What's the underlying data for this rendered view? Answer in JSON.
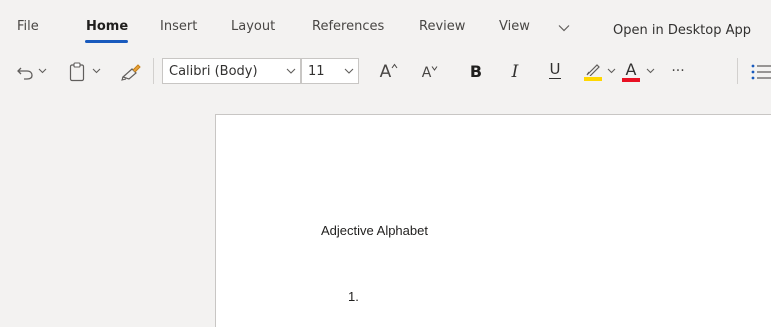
{
  "ribbon": {
    "tabs": [
      {
        "label": "File"
      },
      {
        "label": "Home"
      },
      {
        "label": "Insert"
      },
      {
        "label": "Layout"
      },
      {
        "label": "References"
      },
      {
        "label": "Review"
      },
      {
        "label": "View"
      }
    ],
    "active_tab": "Home",
    "more_tabs_icon": "chevron-down-icon",
    "open_desktop_label": "Open in Desktop App"
  },
  "toolbar": {
    "font_name": "Calibri (Body)",
    "font_size": "11",
    "grow_font_label": "A",
    "shrink_font_label": "A",
    "bold_label": "B",
    "italic_label": "I",
    "underline_label": "U",
    "font_color_label": "A",
    "more_label": "···",
    "highlight_color": "#ffd700",
    "font_color": "#e81123"
  },
  "document": {
    "title": "Adjective Alphabet",
    "list_first_number": "1."
  },
  "colors": {
    "accent": "#185abd",
    "background": "#f3f2f1",
    "page": "#ffffff"
  }
}
